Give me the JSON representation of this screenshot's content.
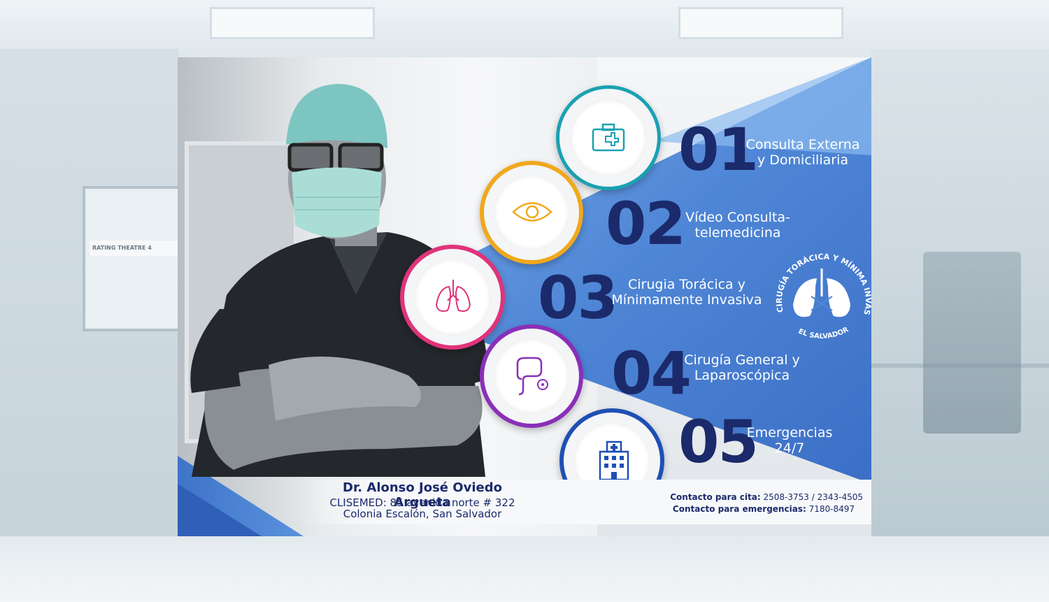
{
  "background": {
    "door_sign": "RATING THEATRE 4"
  },
  "services": [
    {
      "number": "01",
      "line1": "Consulta Externa",
      "line2": "y Domiciliaria",
      "icon": "medical-kit-icon",
      "color": "#1aa1b3"
    },
    {
      "number": "02",
      "line1": "Vídeo Consulta-",
      "line2": "telemedicina",
      "icon": "eye-icon",
      "color": "#f0a81d"
    },
    {
      "number": "03",
      "line1": "Cirugia Torácica y",
      "line2": "Mínimamente Invasiva",
      "icon": "lungs-icon",
      "color": "#e0337a"
    },
    {
      "number": "04",
      "line1": "Cirugía General y",
      "line2": "Laparoscópica",
      "icon": "intestines-icon",
      "color": "#8a2fb8"
    },
    {
      "number": "05",
      "line1": "Emergencias",
      "line2": "24/7",
      "icon": "hospital-icon",
      "color": "#1e4fb4"
    }
  ],
  "doctor": {
    "name": "Dr. Alonso José Oviedo Argueta",
    "address_line1": "CLISEMED: 85 avenida norte # 322",
    "address_line2": "Colonia Escalón, San Salvador"
  },
  "contact": {
    "appointment_label": "Contacto para cita:",
    "appointment_phones": "2508-3753 / 2343-4505",
    "emergency_label": "Contacto para emergencias:",
    "emergency_phone": "7180-8497"
  },
  "logo": {
    "arc_text": "CIRUGÍA TORÁCICA Y MÍNIMA INVASIÓN",
    "bottom_text": "EL SALVADOR"
  },
  "colors": {
    "navy": "#1b2a6b",
    "blue": "#4d86d6",
    "light_blue": "#6aa3e6"
  }
}
